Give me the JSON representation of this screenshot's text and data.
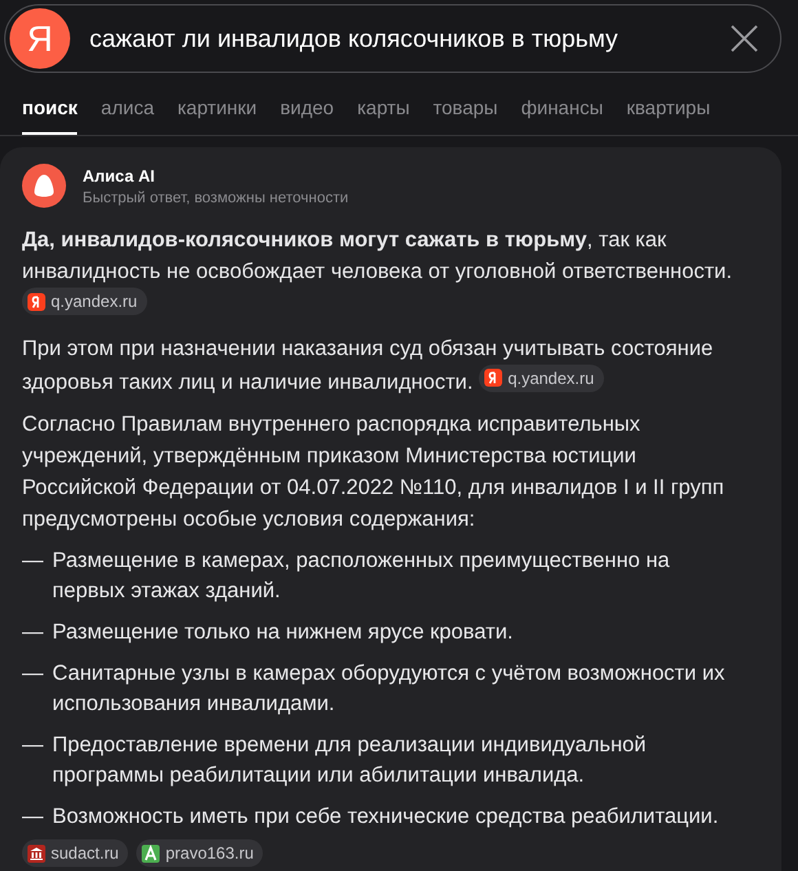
{
  "search": {
    "logo": "Я",
    "value": "сажают ли инвалидов колясочников в тюрьму"
  },
  "tabs": [
    {
      "label": "поиск",
      "selected": true
    },
    {
      "label": "алиса",
      "selected": false
    },
    {
      "label": "картинки",
      "selected": false
    },
    {
      "label": "видео",
      "selected": false
    },
    {
      "label": "карты",
      "selected": false
    },
    {
      "label": "товары",
      "selected": false
    },
    {
      "label": "финансы",
      "selected": false
    },
    {
      "label": "квартиры",
      "selected": false
    }
  ],
  "answer": {
    "author": "Алиса AI",
    "subtitle": "Быстрый ответ, возможны неточности",
    "paragraphs": [
      {
        "text": "**Да, инвалидов-колясочников могут сажать в тюрьму**, так как инвалидность не освобождает человека от уголовной ответственности.",
        "source": {
          "label": "q.yandex.ru",
          "kind": "yandex"
        }
      },
      {
        "text": "При этом при назначении наказания суд обязан учитывать состояние здоровья таких лиц и наличие инвалидности.",
        "source": {
          "label": "q.yandex.ru",
          "kind": "yandex"
        }
      },
      {
        "text": "Согласно Правилам внутреннего распорядка исправительных учреждений, утверждённым приказом Министерства юстиции Российской Федерации от 04.07.2022 №110, для инвалидов I и II групп предусмотрены особые условия содержания:"
      }
    ],
    "bullets": [
      {
        "dash": "—",
        "text": "Размещение в камерах, расположенных преимущественно на первых этажах зданий."
      },
      {
        "dash": "—",
        "text": "Размещение только на нижнем ярусе кровати."
      },
      {
        "dash": "—",
        "text": "Санитарные узлы в камерах оборудуются с учётом возможности их использования инвалидами."
      },
      {
        "dash": "—",
        "text": "Предоставление времени для реализации индивидуальной программы реабилитации или абилитации инвалида."
      },
      {
        "dash": "—",
        "text": "Возможность иметь при себе технические средства реабилитации."
      }
    ],
    "sources": [
      {
        "label": "sudact.ru",
        "kind": "court"
      },
      {
        "label": "pravo163.ru",
        "kind": "pravo"
      }
    ]
  }
}
